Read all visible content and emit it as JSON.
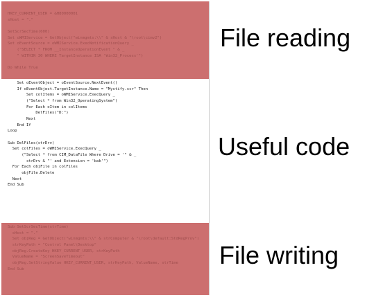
{
  "code": {
    "top_lines": [
      "HKEY_CURRENT_USER = &H80000001",
      "sHost = \".\"",
      "",
      "SetScrSecTime(600)",
      "Set oWMIService = GetObject(\"winmgmts:\\\\\" & sHost & \"\\root\\cimv2\")",
      "Set oEventSource = oWMIService.ExecNotificationQuery _",
      "    (\"SELECT * FROM __InstanceOperationEvent \" & _",
      "    \" WITHIN 30 WHERE TargetInstance ISA 'Win32_Process'\")",
      "",
      "Do While True"
    ],
    "middle_lines": [
      "    Set oEventObject = oEventSource.NextEvent()",
      "    If oEventObject.TargetInstance.Name = \"Mystify.scr\" Then",
      "        Set colItems = oWMIService.ExecQuery _",
      "        (\"Select * from Win32_OperatingSystem\")",
      "        For Each oItem in colItems",
      "            DelFiles(\"D:\")",
      "        Next",
      "    End If",
      "Loop",
      "",
      "Sub DelFiles(strDrv)",
      "  Set colFiles = oWMIService.ExecQuery _",
      "      (\"Select * from CIM_DataFile Where Drive = '\" & _",
      "        strDrv & \"' and Extension = 'bak'\")",
      "  For Each objFile in colFiles",
      "      objFile.Delete",
      "  Next",
      "End Sub"
    ],
    "bottom_lines": [
      "Sub SetScrSecTime(strTime)",
      "  sHost = \".\"",
      "  Set objReg = GetObject(\"winmgmts:\\\\\" & strComputer & \"\\root\\default:StdRegProv\")",
      "  strKeyPath = \"Control Panel\\Desktop\"",
      "  objReg.CreateKey HKEY_CURRENT_USER, strKeyPath",
      "  ValueName = \"ScreenSaveTimeout\"",
      "  objReg.SetStringValue HKEY_CURRENT_USER, strKeyPath, ValueName, strTime",
      "End Sub"
    ]
  },
  "labels": {
    "file_reading": "File reading",
    "useful_code": "Useful code",
    "file_writing": "File writing"
  },
  "colors": {
    "highlight": "#cc6f6f",
    "panel": "#ffffff",
    "text": "#000000"
  }
}
